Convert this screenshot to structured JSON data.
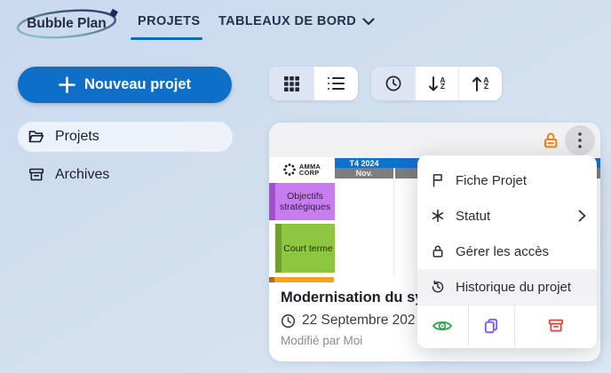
{
  "header": {
    "logo": "Bubble Plan",
    "tabs": [
      {
        "label": "PROJETS",
        "active": true
      },
      {
        "label": "TABLEAUX DE BORD",
        "active": false
      }
    ]
  },
  "sidebar": {
    "new_project_label": "Nouveau projet",
    "items": [
      {
        "label": "Projets",
        "icon": "folder-open-icon",
        "active": true
      },
      {
        "label": "Archives",
        "icon": "archive-icon",
        "active": false
      }
    ]
  },
  "toolbar": {
    "view_icons": [
      "grid-icon",
      "list-icon"
    ],
    "sort_icons": [
      "clock-icon",
      "sort-descending-icon",
      "sort-ascending-icon"
    ],
    "sort_letter_top": "A",
    "sort_letter_bottom": "Z"
  },
  "card": {
    "org_name_line1": "AMMA",
    "org_name_line2": "CORP",
    "timeline": {
      "quarter": "T4 2024",
      "month": "Nov."
    },
    "lanes": [
      {
        "label": "Objectifs stratégiques",
        "color": "#c77df0"
      },
      {
        "label": "Court terme",
        "color": "#8dc63f"
      }
    ],
    "title": "Modernisation du sy",
    "date": "22 Septembre 202",
    "modified_by": "Modifié par Moi",
    "lock_state": "unlocked"
  },
  "menu": {
    "items": [
      {
        "label": "Fiche Projet",
        "icon": "flag-icon"
      },
      {
        "label": "Statut",
        "icon": "asterisk-icon",
        "has_submenu": true
      },
      {
        "label": "Gérer les accès",
        "icon": "lock-icon"
      },
      {
        "label": "Historique du projet",
        "icon": "history-icon",
        "highlighted": true
      }
    ],
    "actions": [
      {
        "icon": "eye-icon"
      },
      {
        "icon": "copy-icon"
      },
      {
        "icon": "archive-icon"
      }
    ]
  },
  "colors": {
    "brand_blue": "#0d6fc8",
    "lock_open_orange": "#f08018",
    "action_view_green": "#2aa64c",
    "action_copy_purple": "#7e5bf0",
    "action_archive_red": "#e43f3a",
    "timeline_blue": "#1170ca",
    "timeline_gray": "#7d7d7f",
    "bar_orange": "#f7a41d"
  }
}
